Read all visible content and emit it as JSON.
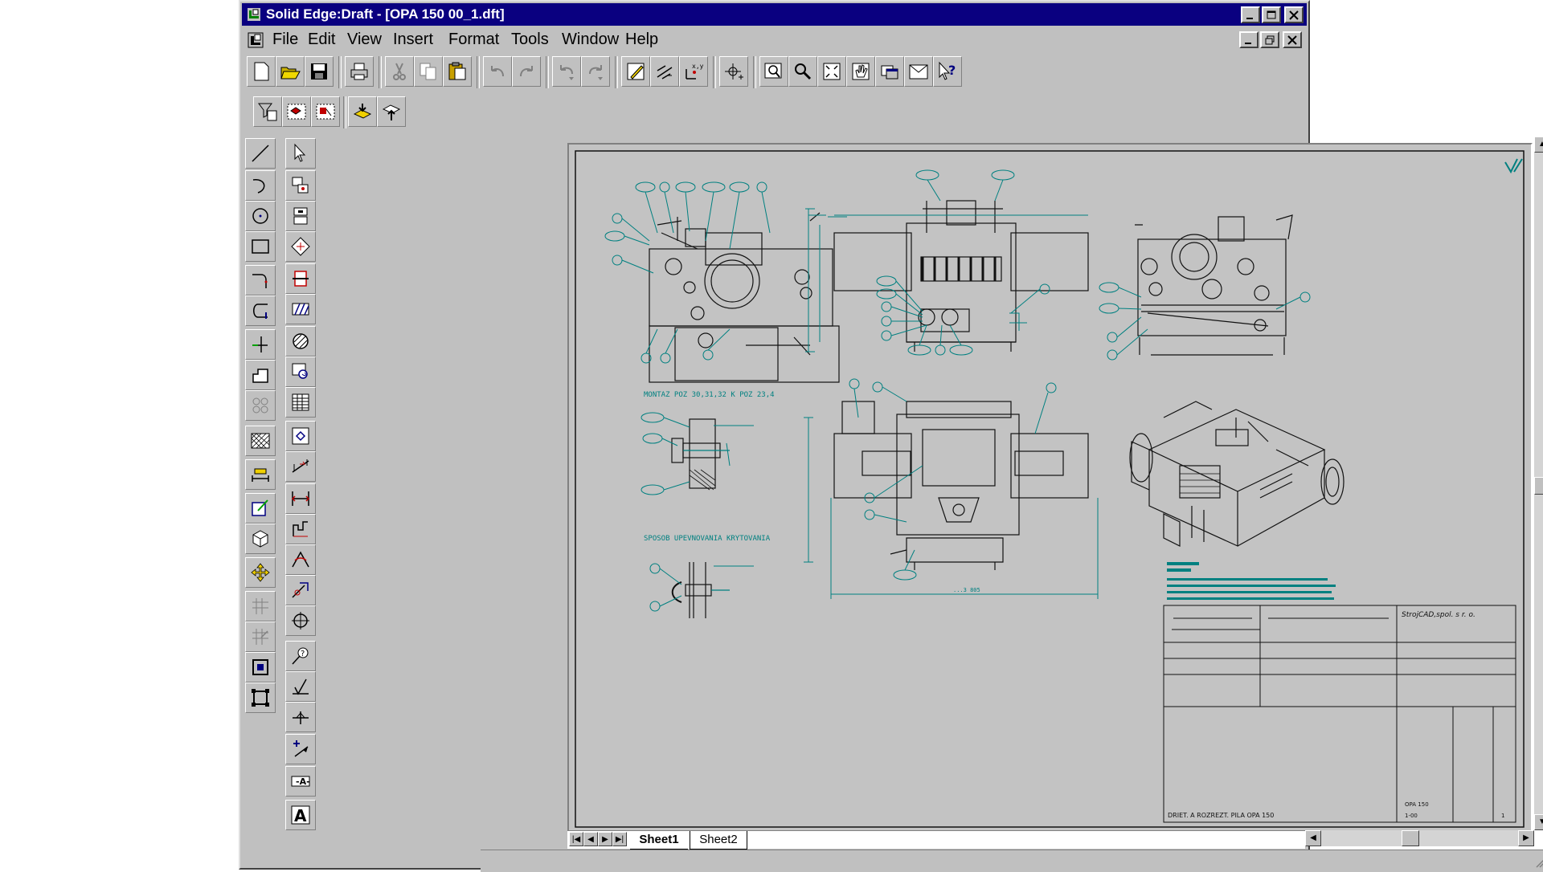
{
  "window": {
    "title": "Solid Edge:Draft - [OPA 150 00_1.dft]"
  },
  "menubar": {
    "items": [
      "File",
      "Edit",
      "View",
      "Insert",
      "Format",
      "Tools",
      "Window",
      "Help"
    ]
  },
  "tabs": [
    "Sheet1",
    "Sheet2"
  ],
  "drawing": {
    "note_1": "MONTAZ POZ 30,31,32 K POZ 23,4",
    "note_2": "SPOSOB UPEVNOVANIA KRYTOVANIA",
    "title_block": {
      "company": "StrojCAD,spol. s r. o.",
      "part_name": "DRIET. A ROZREZT. PILA OPA 150",
      "drawing_no": "OPA 150",
      "sheet_no": "1-00",
      "sheet_count": "1"
    },
    "dimension_bottom": "...3 805"
  },
  "colors": {
    "titlebar": "#0a0080",
    "window": "#c0c0c0",
    "sheet": "#c3c3c3",
    "line_black": "#111111",
    "line_teal": "#00807f"
  }
}
